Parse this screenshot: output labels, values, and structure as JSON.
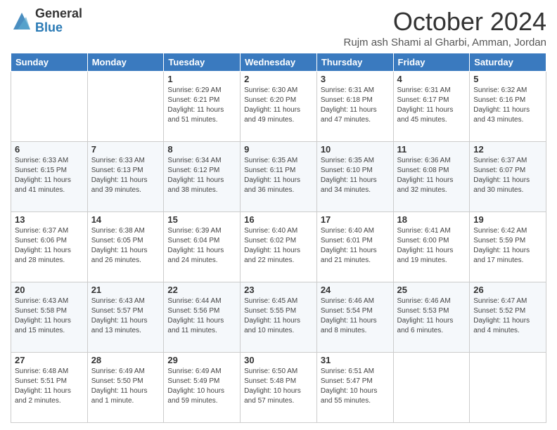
{
  "logo": {
    "general": "General",
    "blue": "Blue"
  },
  "header": {
    "month": "October 2024",
    "location": "Rujm ash Shami al Gharbi, Amman, Jordan"
  },
  "days_of_week": [
    "Sunday",
    "Monday",
    "Tuesday",
    "Wednesday",
    "Thursday",
    "Friday",
    "Saturday"
  ],
  "weeks": [
    [
      {
        "day": "",
        "sunrise": "",
        "sunset": "",
        "daylight": ""
      },
      {
        "day": "",
        "sunrise": "",
        "sunset": "",
        "daylight": ""
      },
      {
        "day": "1",
        "sunrise": "Sunrise: 6:29 AM",
        "sunset": "Sunset: 6:21 PM",
        "daylight": "Daylight: 11 hours and 51 minutes."
      },
      {
        "day": "2",
        "sunrise": "Sunrise: 6:30 AM",
        "sunset": "Sunset: 6:20 PM",
        "daylight": "Daylight: 11 hours and 49 minutes."
      },
      {
        "day": "3",
        "sunrise": "Sunrise: 6:31 AM",
        "sunset": "Sunset: 6:18 PM",
        "daylight": "Daylight: 11 hours and 47 minutes."
      },
      {
        "day": "4",
        "sunrise": "Sunrise: 6:31 AM",
        "sunset": "Sunset: 6:17 PM",
        "daylight": "Daylight: 11 hours and 45 minutes."
      },
      {
        "day": "5",
        "sunrise": "Sunrise: 6:32 AM",
        "sunset": "Sunset: 6:16 PM",
        "daylight": "Daylight: 11 hours and 43 minutes."
      }
    ],
    [
      {
        "day": "6",
        "sunrise": "Sunrise: 6:33 AM",
        "sunset": "Sunset: 6:15 PM",
        "daylight": "Daylight: 11 hours and 41 minutes."
      },
      {
        "day": "7",
        "sunrise": "Sunrise: 6:33 AM",
        "sunset": "Sunset: 6:13 PM",
        "daylight": "Daylight: 11 hours and 39 minutes."
      },
      {
        "day": "8",
        "sunrise": "Sunrise: 6:34 AM",
        "sunset": "Sunset: 6:12 PM",
        "daylight": "Daylight: 11 hours and 38 minutes."
      },
      {
        "day": "9",
        "sunrise": "Sunrise: 6:35 AM",
        "sunset": "Sunset: 6:11 PM",
        "daylight": "Daylight: 11 hours and 36 minutes."
      },
      {
        "day": "10",
        "sunrise": "Sunrise: 6:35 AM",
        "sunset": "Sunset: 6:10 PM",
        "daylight": "Daylight: 11 hours and 34 minutes."
      },
      {
        "day": "11",
        "sunrise": "Sunrise: 6:36 AM",
        "sunset": "Sunset: 6:08 PM",
        "daylight": "Daylight: 11 hours and 32 minutes."
      },
      {
        "day": "12",
        "sunrise": "Sunrise: 6:37 AM",
        "sunset": "Sunset: 6:07 PM",
        "daylight": "Daylight: 11 hours and 30 minutes."
      }
    ],
    [
      {
        "day": "13",
        "sunrise": "Sunrise: 6:37 AM",
        "sunset": "Sunset: 6:06 PM",
        "daylight": "Daylight: 11 hours and 28 minutes."
      },
      {
        "day": "14",
        "sunrise": "Sunrise: 6:38 AM",
        "sunset": "Sunset: 6:05 PM",
        "daylight": "Daylight: 11 hours and 26 minutes."
      },
      {
        "day": "15",
        "sunrise": "Sunrise: 6:39 AM",
        "sunset": "Sunset: 6:04 PM",
        "daylight": "Daylight: 11 hours and 24 minutes."
      },
      {
        "day": "16",
        "sunrise": "Sunrise: 6:40 AM",
        "sunset": "Sunset: 6:02 PM",
        "daylight": "Daylight: 11 hours and 22 minutes."
      },
      {
        "day": "17",
        "sunrise": "Sunrise: 6:40 AM",
        "sunset": "Sunset: 6:01 PM",
        "daylight": "Daylight: 11 hours and 21 minutes."
      },
      {
        "day": "18",
        "sunrise": "Sunrise: 6:41 AM",
        "sunset": "Sunset: 6:00 PM",
        "daylight": "Daylight: 11 hours and 19 minutes."
      },
      {
        "day": "19",
        "sunrise": "Sunrise: 6:42 AM",
        "sunset": "Sunset: 5:59 PM",
        "daylight": "Daylight: 11 hours and 17 minutes."
      }
    ],
    [
      {
        "day": "20",
        "sunrise": "Sunrise: 6:43 AM",
        "sunset": "Sunset: 5:58 PM",
        "daylight": "Daylight: 11 hours and 15 minutes."
      },
      {
        "day": "21",
        "sunrise": "Sunrise: 6:43 AM",
        "sunset": "Sunset: 5:57 PM",
        "daylight": "Daylight: 11 hours and 13 minutes."
      },
      {
        "day": "22",
        "sunrise": "Sunrise: 6:44 AM",
        "sunset": "Sunset: 5:56 PM",
        "daylight": "Daylight: 11 hours and 11 minutes."
      },
      {
        "day": "23",
        "sunrise": "Sunrise: 6:45 AM",
        "sunset": "Sunset: 5:55 PM",
        "daylight": "Daylight: 11 hours and 10 minutes."
      },
      {
        "day": "24",
        "sunrise": "Sunrise: 6:46 AM",
        "sunset": "Sunset: 5:54 PM",
        "daylight": "Daylight: 11 hours and 8 minutes."
      },
      {
        "day": "25",
        "sunrise": "Sunrise: 6:46 AM",
        "sunset": "Sunset: 5:53 PM",
        "daylight": "Daylight: 11 hours and 6 minutes."
      },
      {
        "day": "26",
        "sunrise": "Sunrise: 6:47 AM",
        "sunset": "Sunset: 5:52 PM",
        "daylight": "Daylight: 11 hours and 4 minutes."
      }
    ],
    [
      {
        "day": "27",
        "sunrise": "Sunrise: 6:48 AM",
        "sunset": "Sunset: 5:51 PM",
        "daylight": "Daylight: 11 hours and 2 minutes."
      },
      {
        "day": "28",
        "sunrise": "Sunrise: 6:49 AM",
        "sunset": "Sunset: 5:50 PM",
        "daylight": "Daylight: 11 hours and 1 minute."
      },
      {
        "day": "29",
        "sunrise": "Sunrise: 6:49 AM",
        "sunset": "Sunset: 5:49 PM",
        "daylight": "Daylight: 10 hours and 59 minutes."
      },
      {
        "day": "30",
        "sunrise": "Sunrise: 6:50 AM",
        "sunset": "Sunset: 5:48 PM",
        "daylight": "Daylight: 10 hours and 57 minutes."
      },
      {
        "day": "31",
        "sunrise": "Sunrise: 6:51 AM",
        "sunset": "Sunset: 5:47 PM",
        "daylight": "Daylight: 10 hours and 55 minutes."
      },
      {
        "day": "",
        "sunrise": "",
        "sunset": "",
        "daylight": ""
      },
      {
        "day": "",
        "sunrise": "",
        "sunset": "",
        "daylight": ""
      }
    ]
  ]
}
